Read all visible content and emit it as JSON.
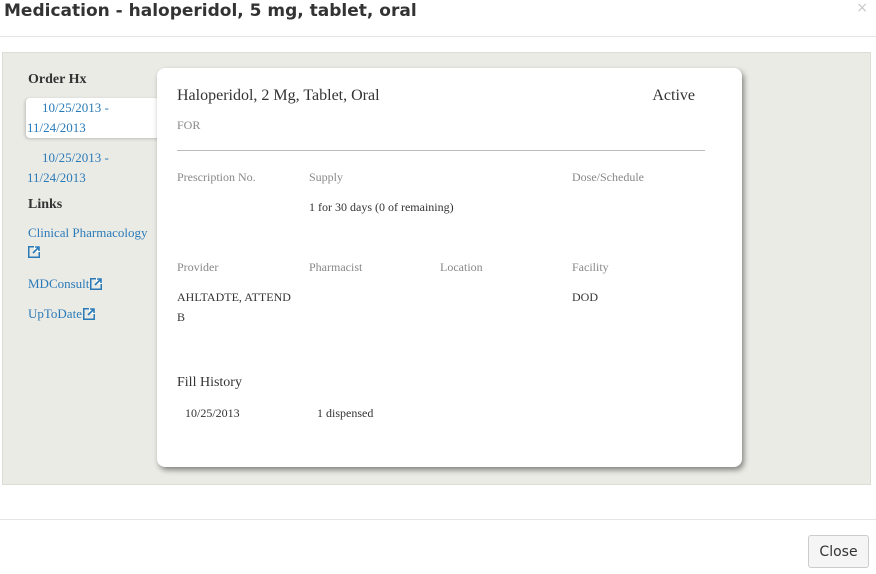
{
  "dialog": {
    "title": "Medication - haloperidol, 5 mg, tablet, oral",
    "close_symbol": "×"
  },
  "sidebar": {
    "order_hx_title": "Order Hx",
    "orders": [
      {
        "line1": "10/25/2013 -",
        "line2": "11/24/2013",
        "active": true
      },
      {
        "line1": "10/25/2013 -",
        "line2": "11/24/2013",
        "active": false
      }
    ],
    "links_title": "Links",
    "links": [
      {
        "label": "Clinical Pharmacology",
        "icon": "external-link-icon"
      },
      {
        "label": "MDConsult",
        "icon": "external-link-icon"
      },
      {
        "label": "UpToDate",
        "icon": "external-link-icon"
      }
    ]
  },
  "detail": {
    "drug_name": "Haloperidol, 2 Mg, Tablet, Oral",
    "status": "Active",
    "for_label": "FOR",
    "prescription_label": "Prescription No.",
    "supply_label": "Supply",
    "supply_value": "1 for 30 days (0 of remaining)",
    "dose_label": "Dose/Schedule",
    "provider_label": "Provider",
    "provider_value_line1": "AHLTADTE, ATTEND",
    "provider_value_line2": "B",
    "pharmacist_label": "Pharmacist",
    "location_label": "Location",
    "facility_label": "Facility",
    "facility_value": "DOD",
    "fill_history_title": "Fill History",
    "fill_history": [
      {
        "date": "10/25/2013",
        "status": "1 dispensed"
      }
    ]
  },
  "footer": {
    "close_label": "Close"
  },
  "colors": {
    "link": "#2a7ab8",
    "panel_bg": "#ebebe6"
  }
}
